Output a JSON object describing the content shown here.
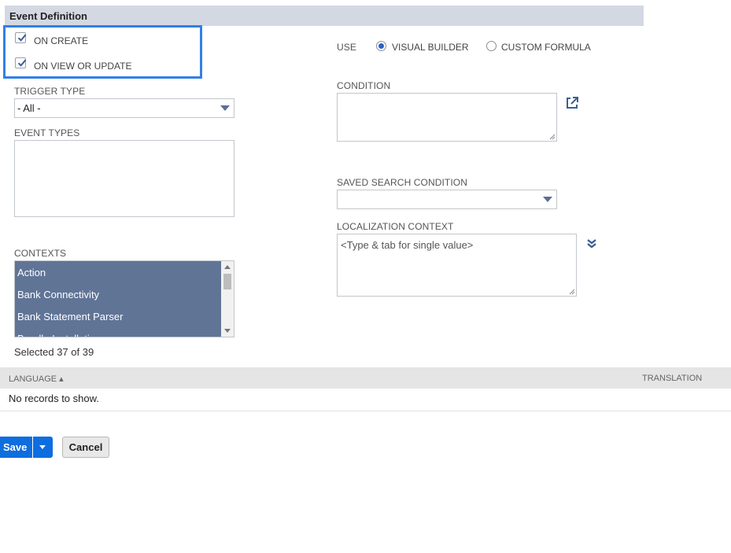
{
  "section": {
    "title": "Event Definition"
  },
  "left": {
    "on_create": {
      "label": "ON CREATE",
      "checked": true
    },
    "on_view_or_update": {
      "label": "ON VIEW OR UPDATE",
      "checked": true
    },
    "trigger_type": {
      "label": "TRIGGER TYPE",
      "value": "- All -"
    },
    "event_types": {
      "label": "EVENT TYPES"
    },
    "contexts": {
      "label": "CONTEXTS",
      "items": [
        "Action",
        "Bank Connectivity",
        "Bank Statement Parser",
        "Bundle Installation"
      ],
      "selected_text": "Selected 37 of 39"
    }
  },
  "right": {
    "use_label": "USE",
    "visual_builder": {
      "label": "VISUAL BUILDER",
      "selected": true
    },
    "custom_formula": {
      "label": "CUSTOM FORMULA",
      "selected": false
    },
    "condition": {
      "label": "CONDITION"
    },
    "saved_search_condition": {
      "label": "SAVED SEARCH CONDITION",
      "value": ""
    },
    "localization_context": {
      "label": "LOCALIZATION CONTEXT",
      "placeholder": "<Type & tab for single value>"
    }
  },
  "table": {
    "columns": [
      "LANGUAGE ▴",
      "TRANSLATION"
    ],
    "empty_text": "No records to show."
  },
  "buttons": {
    "save": "Save",
    "cancel": "Cancel"
  },
  "colors": {
    "accent": "#0e6ddf",
    "highlight": "#3080e8",
    "list_selected": "#607496",
    "icon": "#3a5f94"
  },
  "icons": {
    "check": "checkmark-icon",
    "popout": "external-link-icon",
    "expand": "double-chevron-down-icon",
    "dropdown": "caret-down-icon"
  }
}
